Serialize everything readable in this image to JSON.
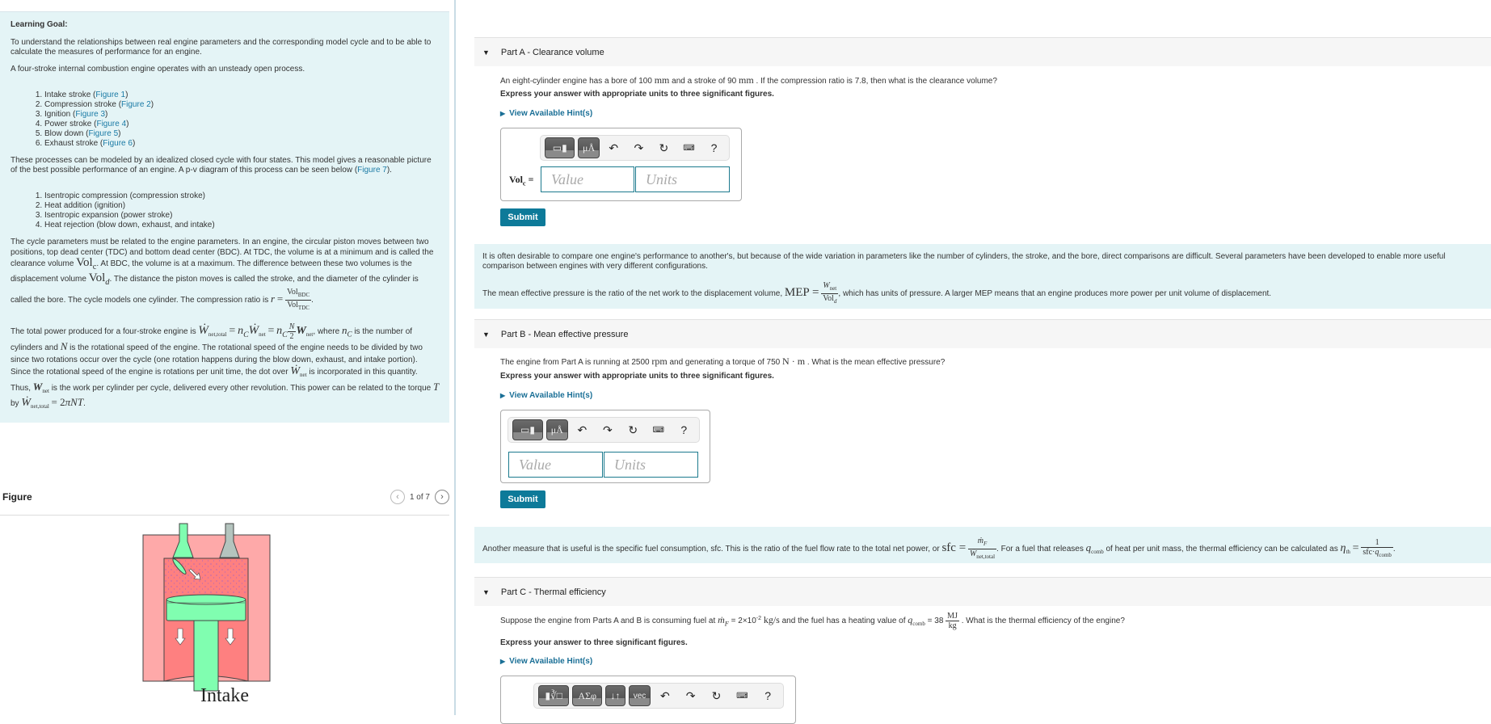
{
  "intro": {
    "goal_title": "Learning Goal:",
    "goal_text": "To understand the relationships between real engine parameters and the corresponding model cycle and to be able to calculate the measures of performance for an engine.",
    "process_text": "A four-stroke internal combustion engine operates with an unsteady open process.",
    "strokes": [
      {
        "label": "Intake stroke",
        "link": "Figure 1"
      },
      {
        "label": "Compression stroke",
        "link": "Figure 2"
      },
      {
        "label": "Ignition",
        "link": "Figure 3"
      },
      {
        "label": "Power stroke",
        "link": "Figure 4"
      },
      {
        "label": "Blow down",
        "link": "Figure 5"
      },
      {
        "label": "Exhaust stroke",
        "link": "Figure 6"
      }
    ],
    "model_text": "These processes can be modeled by an idealized closed cycle with four states. This model gives a reasonable picture of the best possible performance of an engine. A p-v diagram of this process can be seen below",
    "model_link": "Figure 7",
    "cycle_steps": [
      "Isentropic compression (compression stroke)",
      "Heat addition (ignition)",
      "Isentropic expansion (power stroke)",
      "Heat rejection (blow down, exhaust, and intake)"
    ],
    "params_text_1": "The cycle parameters must be related to the engine parameters. In an engine, the circular piston moves between two positions, top dead center (TDC) and bottom dead center (BDC). At TDC, the volume is at a minimum and is called the clearance volume",
    "params_text_2": ". At BDC, the volume is at a maximum. The difference between these two volumes is the displacement volume",
    "params_text_3": ". The distance the piston moves is called the stroke, and the diameter of the cylinder is called the bore. The cycle models one cylinder. The compression ratio is",
    "power_text_1": "The total power produced for a four-stroke engine is",
    "power_text_2": ", where",
    "power_text_3": "is the number of cylinders and",
    "power_text_4": "is the rotational speed of the engine. The rotational speed of the engine needs to be divided by two since two rotations occur over the cycle (one rotation happens during the blow down, exhaust, and intake portion). Since the rotational speed of the engine is rotations per unit time, the dot over",
    "power_text_5": "is incorporated in this quantity. Thus,",
    "power_text_6": "is the work per cylinder per cycle, delivered every other revolution. This power can be related to the torque",
    "power_text_7": "by"
  },
  "figure": {
    "title": "Figure",
    "counter": "1 of 7",
    "caption": "Intake",
    "colors": {
      "outer_block": "#fea9a9",
      "chamber": "#fe8080",
      "piston": "#80feb0",
      "exhaust_valve": "#b4c4be"
    }
  },
  "partA": {
    "header": "Part A - Clearance volume",
    "question_1": "An eight-cylinder engine has a bore of 100",
    "question_unit_1": "mm",
    "question_2": "and a stroke of 90",
    "question_unit_2": "mm",
    "question_3": ". If the compression ratio is 7.8, then what is the clearance volume?",
    "instruction": "Express your answer with appropriate units to three significant figures.",
    "hint": "View Available Hint(s)",
    "var_label": "Vol",
    "var_sub": "c",
    "value_placeholder": "Value",
    "units_placeholder": "Units",
    "submit": "Submit",
    "toolbar": {
      "btn1": "templates",
      "btn2": "μÅ",
      "help": "?"
    }
  },
  "mep_info": {
    "text_1": "It is often desirable to compare one engine's performance to another's, but because of the wide variation in parameters like the number of cylinders, the stroke, and the bore, direct comparisons are difficult. Several parameters have been developed to enable more useful comparison between engines with very different configurations.",
    "text_2": "The mean effective pressure is the ratio of the net work to the displacement volume,",
    "text_3": ", which has units of pressure. A larger MEP means that an engine produces more power per unit volume of displacement."
  },
  "partB": {
    "header": "Part B - Mean effective pressure",
    "question_1": "The engine from Part A is running at 2500",
    "question_unit_1": "rpm",
    "question_2": "and generating a torque of 750",
    "question_unit_2": "N · m",
    "question_3": ". What is the mean effective pressure?",
    "instruction": "Express your answer with appropriate units to three significant figures.",
    "hint": "View Available Hint(s)",
    "value_placeholder": "Value",
    "units_placeholder": "Units",
    "submit": "Submit",
    "toolbar": {
      "btn2": "μÅ",
      "help": "?"
    }
  },
  "sfc_info": {
    "text_1": "Another measure that is useful is the specific fuel consumption, sfc. This is the ratio of the fuel flow rate to the total net power, or",
    "text_2": ". For a fuel that releases",
    "text_3": "of heat per unit mass, the thermal efficiency can be calculated as"
  },
  "partC": {
    "header": "Part C - Thermal efficiency",
    "question_1": "Suppose the engine from Parts A and B is consuming fuel at",
    "question_2": "= 2×10",
    "question_exp": "-2",
    "question_unit_1": "kg/s",
    "question_3": "and the fuel has a heating value of",
    "question_4": "= 38",
    "question_5": ". What is the thermal efficiency of the engine?",
    "instruction": "Express your answer to three significant figures.",
    "hint": "View Available Hint(s)",
    "toolbar": {
      "btn2": "ΑΣφ",
      "btn3": "↓↑",
      "btn4": "vec",
      "help": "?"
    }
  }
}
